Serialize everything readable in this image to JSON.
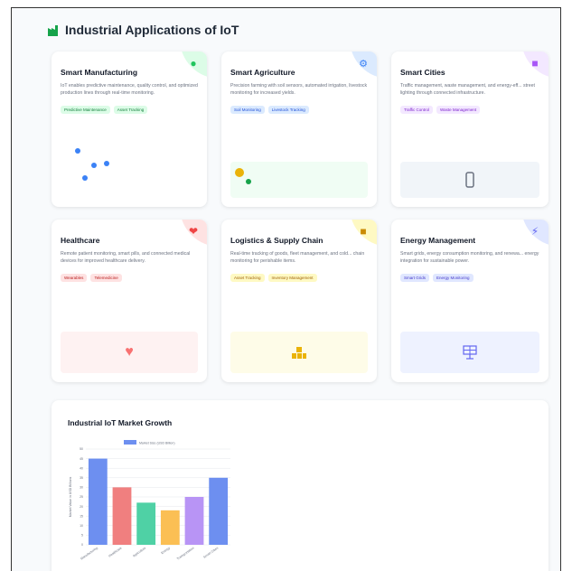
{
  "header": {
    "title": "Industrial Applications of IoT"
  },
  "colors": {
    "accent": "#16a34a"
  },
  "cards": [
    {
      "title": "Smart Manufacturing",
      "desc": "IoT enables predictive maintenance, quality control, and optimized production lines through real-time monitoring.",
      "tags": [
        "Predictive Maintenance",
        "Asset Tracking"
      ],
      "icon": "gear-icon",
      "color": "#22c55e",
      "tint": "#dcfce7"
    },
    {
      "title": "Smart Agriculture",
      "desc": "Precision farming with soil sensors, automated irrigation, livestock monitoring for increased yields.",
      "tags": [
        "Soil Monitoring",
        "Livestock Tracking"
      ],
      "icon": "tractor-icon",
      "color": "#3b82f6",
      "tint": "#dbeafe"
    },
    {
      "title": "Smart Cities",
      "desc": "Traffic management, waste management, and energy-eff... street lighting through connected infrastructure.",
      "tags": [
        "Traffic Control",
        "Waste Management"
      ],
      "icon": "city-icon",
      "color": "#a855f7",
      "tint": "#f3e8ff"
    },
    {
      "title": "Healthcare",
      "desc": "Remote patient monitoring, smart pills, and connected medical devices for improved healthcare delivery.",
      "tags": [
        "Wearables",
        "Telemedicine"
      ],
      "icon": "health-icon",
      "color": "#ef4444",
      "tint": "#fee2e2"
    },
    {
      "title": "Logistics & Supply Chain",
      "desc": "Real-time tracking of goods, fleet management, and cold... chain monitoring for perishable items.",
      "tags": [
        "Asset Tracking",
        "Inventory Management"
      ],
      "icon": "truck-icon",
      "color": "#eab308",
      "tint": "#fef9c3"
    },
    {
      "title": "Energy Management",
      "desc": "Smart grids, energy consumption monitoring, and renewa... energy integration for sustainable power.",
      "tags": [
        "Smart Grids",
        "Energy Monitoring"
      ],
      "icon": "bolt-icon",
      "color": "#6366f1",
      "tint": "#e0e7ff"
    }
  ],
  "chart": {
    "title": "Industrial IoT Market Growth"
  },
  "chart_data": {
    "type": "bar",
    "title": "Industrial IoT Market Growth",
    "legend": "Market Size (USD Billion)",
    "ylabel": "Market Value in USD Billions",
    "categories": [
      "Manufacturing",
      "Healthcare",
      "Agriculture",
      "Energy",
      "Transportation",
      "Smart Cities"
    ],
    "values": [
      45,
      30,
      22,
      18,
      25,
      35
    ],
    "ylim": [
      0,
      50
    ],
    "yticks": [
      "0",
      "5",
      "10",
      "15",
      "20",
      "25",
      "30",
      "35",
      "40",
      "45",
      "50"
    ],
    "colors": [
      "#6d8ff0",
      "#f07f7f",
      "#4fd1a5",
      "#fbbf54",
      "#b894f5",
      "#6d8ff0"
    ],
    "grid": true,
    "legend_position": "top"
  }
}
